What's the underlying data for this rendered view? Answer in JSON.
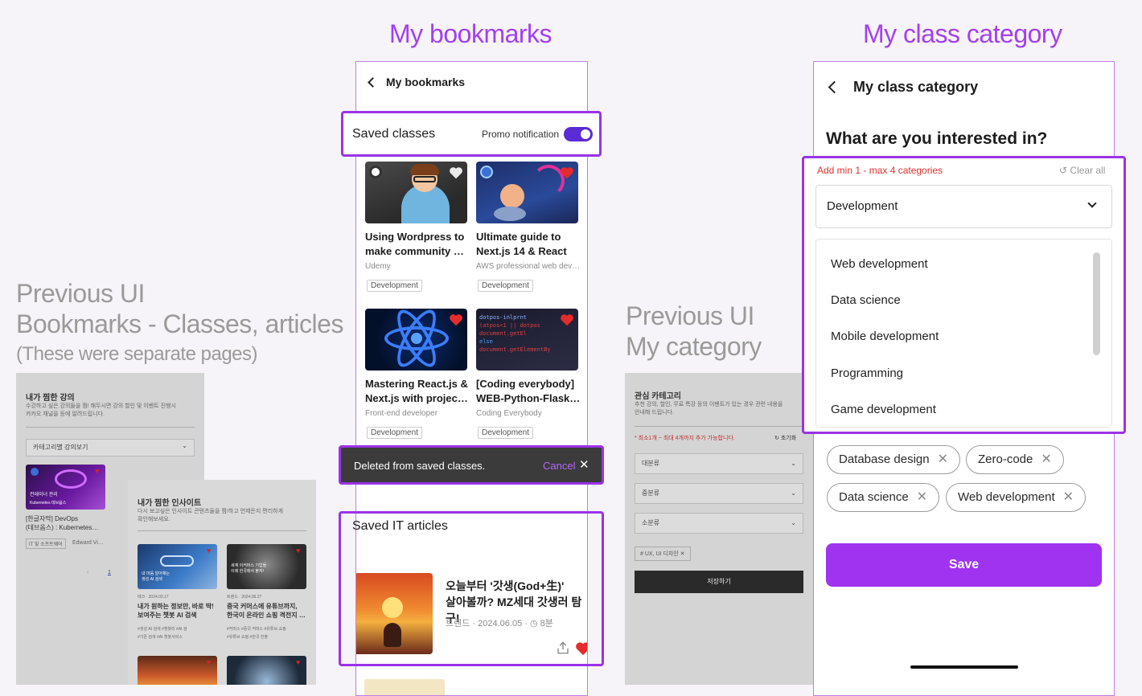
{
  "headings": {
    "bookmarks": "My bookmarks",
    "category": "My class category",
    "prev_bookmarks_line1": "Previous UI",
    "prev_bookmarks_line2": "Bookmarks - Classes, articles",
    "prev_bookmarks_note": "(These were separate pages)",
    "prev_category_line1": "Previous UI",
    "prev_category_line2": "My category"
  },
  "prev_bookmarks": {
    "page1": {
      "title": "내가 찜한 강의",
      "desc1": "수강하고 싶은 강의들을 찜! 해두시면 강의 할인 및 이벤트 진행시",
      "desc2": "카카오 채널을 등에 알려드립니다.",
      "select": "카테고리별 강의보기",
      "card_title1": "[한글자막] DevOps",
      "card_title2": "(데브옵스) : Kubernetes…",
      "tag1": "IT 및 소프트웨어",
      "tag2": "Edward Vi…",
      "page_num": "1",
      "thumb_text1": "컨테이너 관리",
      "thumb_text2": "Kubernetes 데브옵스"
    },
    "page2": {
      "title": "내가 찜한 인사이트",
      "desc1": "다시 보고싶은 인사이트 콘텐츠들을 찜!하고 언제든지 편리하게",
      "desc2": "확인해보세요.",
      "a1_meta": "테크 · 2024.03.17",
      "a1_title1": "내가 원하는 정보만, 바로 딱!",
      "a1_title2": "보여주는 챗봇 AI 검색",
      "a1_tags1": "#생성 AI 검색  #챗봇리   #AI 검",
      "a1_tags2": "#기존 검색  #AI 챗봇서비스",
      "a1_thumb1": "내 마음 알아채는",
      "a1_thumb2": "생성 AI 검색",
      "a2_meta": "트렌드 · 2024.06.27",
      "a2_title1": "중국 커머스에 유튜브까지,",
      "a2_title2": "한국이 온라인 쇼핑 격전지 …",
      "a2_tags1": "#커머스  #중국 커머스  #유튜브 쇼핑",
      "a2_tags2": "#유튜브 쇼핑  #한국 진출",
      "a2_thumb1": "세계 이커머스 기업들",
      "a2_thumb2": "이제 한국에서 붙자!"
    }
  },
  "bookmarks": {
    "header": "My bookmarks",
    "section_title": "Saved classes",
    "promo_label": "Promo notification",
    "cards": [
      {
        "title1": "Using Wordpress to",
        "title2": "make community …",
        "sub": "Udemy",
        "tag": "Development"
      },
      {
        "title1": "Ultimate guide to",
        "title2": "Next.js 14 & React",
        "sub": "AWS professional web dev…",
        "tag": "Development"
      },
      {
        "title1": "Mastering React.js &",
        "title2": "Next.js with projec…",
        "sub": "Front-end developer",
        "tag": "Development"
      },
      {
        "title1": "[Coding everybody]",
        "title2": "WEB-Python-Flask…",
        "sub": "Coding Everybody",
        "tag": "Development"
      }
    ],
    "toast_text": "Deleted from saved classes.",
    "toast_action": "Cancel",
    "articles_title": "Saved IT articles",
    "article": {
      "title1": "오늘부터 '갓생(God+生)'",
      "title2": "살아볼까? MZ세대 갓생러 탐구!",
      "meta": "트렌드 · 2024.06.05 · ",
      "minutes": "8분"
    }
  },
  "prev_category": {
    "title": "관심 카테고리",
    "desc1": "추천 강의, 할인, 무료 특강 등의 이벤트가 있는 경우 관련 내용을",
    "desc2": "안내해 드립니다.",
    "note": "* 최소1개 ~ 최대 4개까지 추가 가능합니다.",
    "reset": "초기화",
    "select1": "대분류",
    "select2": "중분류",
    "select3": "소분류",
    "chip": "# UX, UI 디자인",
    "save": "저장하기"
  },
  "category": {
    "header": "My class category",
    "question": "What are you interested in?",
    "limit_note": "Add min 1 - max 4 categories",
    "clear_all": "Clear all",
    "selected": "Development",
    "options": [
      "Web development",
      "Data science",
      "Mobile development",
      "Programming",
      "Game development"
    ],
    "chips": [
      "Database design",
      "Zero-code",
      "Data science",
      "Web development"
    ],
    "save": "Save"
  },
  "colors": {
    "accent": "#9a33e6",
    "button": "#a033f0",
    "toggle": "#5a2bd6",
    "limit_red": "#e0322d",
    "heart": "#e52b2b"
  }
}
